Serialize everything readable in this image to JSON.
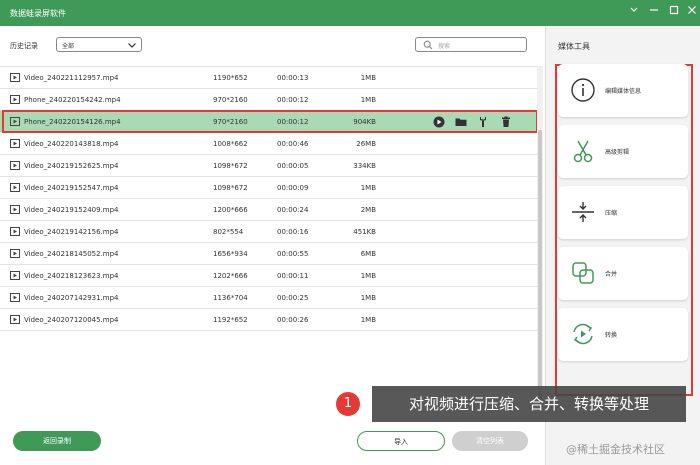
{
  "window": {
    "title": "数据蛙录屏软件",
    "controls": [
      "restore-down-icon",
      "minimize-icon",
      "maximize-icon",
      "close-icon"
    ]
  },
  "toolbar": {
    "history_label": "历史记录",
    "filter_value": "全部",
    "search_placeholder": "搜索"
  },
  "files": [
    {
      "name": "Video_240221112957.mp4",
      "resolution": "1190*652",
      "duration": "00:00:13",
      "size": "1MB"
    },
    {
      "name": "Phone_240220154242.mp4",
      "resolution": "970*2160",
      "duration": "00:00:12",
      "size": "1MB"
    },
    {
      "name": "Phone_240220154126.mp4",
      "resolution": "970*2160",
      "duration": "00:00:12",
      "size": "904KB"
    },
    {
      "name": "Video_240220143818.mp4",
      "resolution": "1008*662",
      "duration": "00:00:46",
      "size": "26MB"
    },
    {
      "name": "Video_240219152625.mp4",
      "resolution": "1098*672",
      "duration": "00:00:05",
      "size": "334KB"
    },
    {
      "name": "Video_240219152547.mp4",
      "resolution": "1098*672",
      "duration": "00:00:09",
      "size": "1MB"
    },
    {
      "name": "Video_240219152409.mp4",
      "resolution": "1200*666",
      "duration": "00:00:24",
      "size": "2MB"
    },
    {
      "name": "Video_240219142156.mp4",
      "resolution": "802*554",
      "duration": "00:00:16",
      "size": "451KB"
    },
    {
      "name": "Video_240218145052.mp4",
      "resolution": "1656*934",
      "duration": "00:00:55",
      "size": "6MB"
    },
    {
      "name": "Video_240218123623.mp4",
      "resolution": "1202*666",
      "duration": "00:00:11",
      "size": "1MB"
    },
    {
      "name": "Video_240207142931.mp4",
      "resolution": "1136*704",
      "duration": "00:00:25",
      "size": "1MB"
    },
    {
      "name": "Video_240207120045.mp4",
      "resolution": "1192*652",
      "duration": "00:00:26",
      "size": "1MB"
    }
  ],
  "media_tools": {
    "heading": "媒体工具",
    "items": [
      {
        "label": "编辑媒体信息",
        "icon": "info-icon"
      },
      {
        "label": "高级剪辑",
        "icon": "scissors-icon"
      },
      {
        "label": "压缩",
        "icon": "compress-icon"
      },
      {
        "label": "合并",
        "icon": "merge-icon"
      },
      {
        "label": "转换",
        "icon": "convert-icon"
      }
    ]
  },
  "buttons": {
    "back": "返回录制",
    "import": "导入",
    "clear": "清空列表"
  },
  "callout": {
    "number": "1",
    "text": "对视频进行压缩、合并、转换等处理"
  },
  "watermark": "@稀土掘金技术社区",
  "colors": {
    "accent": "#3f9a58",
    "selected_row": "#a9d9b5",
    "highlight": "#e53935"
  }
}
